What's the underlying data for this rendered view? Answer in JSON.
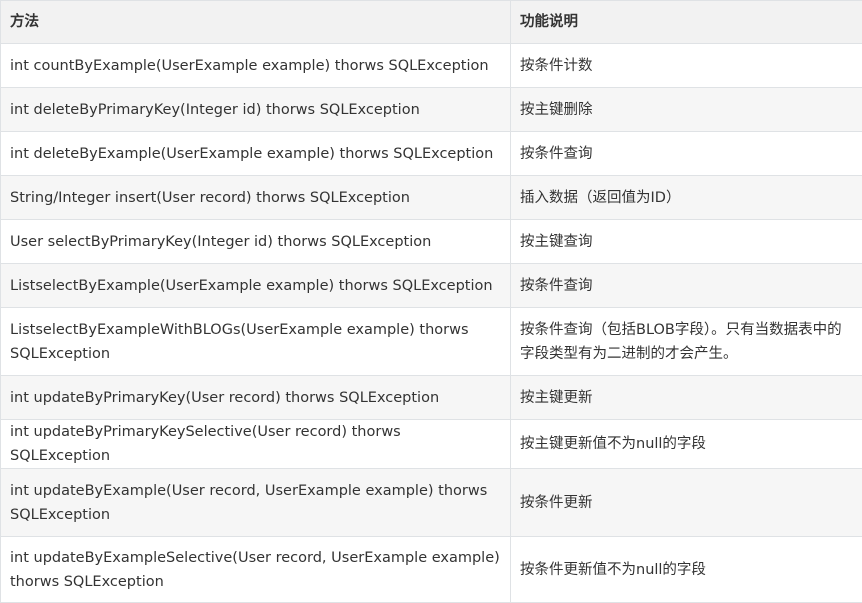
{
  "table": {
    "headers": {
      "method": "方法",
      "description": "功能说明"
    },
    "rows": [
      {
        "method": "int countByExample(UserExample example) thorws SQLException",
        "description": "按条件计数"
      },
      {
        "method": "int deleteByPrimaryKey(Integer id) thorws SQLException",
        "description": "按主键删除"
      },
      {
        "method": "int deleteByExample(UserExample example) thorws SQLException",
        "description": "按条件查询"
      },
      {
        "method": "String/Integer insert(User record) thorws SQLException",
        "description": "插入数据（返回值为ID）"
      },
      {
        "method": "User selectByPrimaryKey(Integer id) thorws SQLException",
        "description": "按主键查询"
      },
      {
        "method": "ListselectByExample(UserExample example) thorws SQLException",
        "description": "按条件查询"
      },
      {
        "method": "ListselectByExampleWithBLOGs(UserExample example) thorws SQLException",
        "description": "按条件查询（包括BLOB字段）。只有当数据表中的字段类型有为二进制的才会产生。"
      },
      {
        "method": "int updateByPrimaryKey(User record) thorws SQLException",
        "description": "按主键更新"
      },
      {
        "method": "int updateByPrimaryKeySelective(User record) thorws SQLException",
        "description": "按主键更新值不为null的字段"
      },
      {
        "method": "int updateByExample(User record, UserExample example) thorws SQLException",
        "description": "按条件更新"
      },
      {
        "method": "int updateByExampleSelective(User record, UserExample example) thorws SQLException",
        "description": "按条件更新值不为null的字段"
      }
    ]
  }
}
